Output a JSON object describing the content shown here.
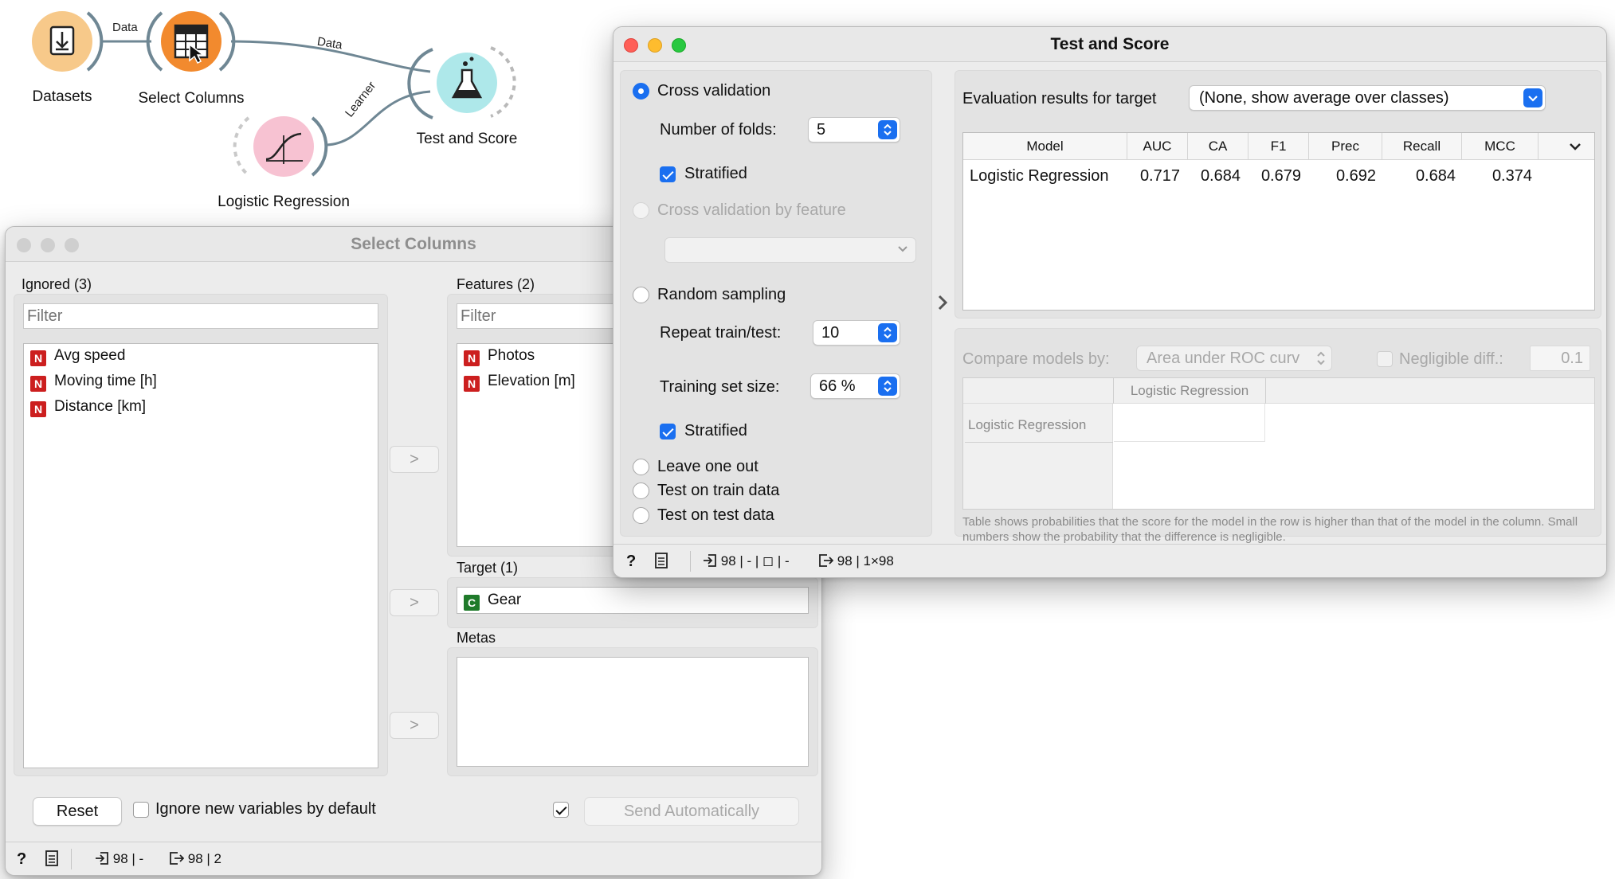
{
  "workflow": {
    "nodes": [
      {
        "label": "Datasets",
        "icon": "file-download-icon"
      },
      {
        "label": "Select Columns",
        "icon": "table-cursor-icon"
      },
      {
        "label": "Test and Score",
        "icon": "flask-icon"
      },
      {
        "label": "Logistic Regression",
        "icon": "sigmoid-curve-icon"
      }
    ],
    "links": [
      "Data",
      "Data",
      "Learner"
    ]
  },
  "select_columns": {
    "title": "Select Columns",
    "ignored": {
      "label": "Ignored (3)",
      "filter_placeholder": "Filter",
      "items": [
        {
          "tag": "N",
          "name": "Avg speed"
        },
        {
          "tag": "N",
          "name": "Moving time [h]"
        },
        {
          "tag": "N",
          "name": "Distance [km]"
        }
      ]
    },
    "features": {
      "label": "Features (2)",
      "filter_placeholder": "Filter",
      "items": [
        {
          "tag": "N",
          "name": "Photos"
        },
        {
          "tag": "N",
          "name": "Elevation [m]"
        }
      ]
    },
    "target": {
      "label": "Target (1)",
      "items": [
        {
          "tag": "C",
          "name": "Gear"
        }
      ]
    },
    "metas": {
      "label": "Metas",
      "items": []
    },
    "move_button": ">",
    "reset_label": "Reset",
    "ignore_new_label": "Ignore new variables by default",
    "send_label": "Send Automatically",
    "status": {
      "input": "98 | -",
      "output": "98 | 2"
    }
  },
  "test_and_score": {
    "title": "Test and Score",
    "cross_validation": "Cross validation",
    "folds_label": "Number of folds:",
    "folds_value": "5",
    "stratified_label": "Stratified",
    "cv_by_feature": "Cross validation by feature",
    "random_sampling": "Random sampling",
    "repeat_label": "Repeat train/test:",
    "repeat_value": "10",
    "train_size_label": "Training set size:",
    "train_size_value": "66 %",
    "leave_one_out": "Leave one out",
    "test_on_train": "Test on train data",
    "test_on_test": "Test on test data",
    "eval_label": "Evaluation results for target",
    "target_value": "(None, show average over classes)",
    "columns": [
      "Model",
      "AUC",
      "CA",
      "F1",
      "Prec",
      "Recall",
      "MCC"
    ],
    "rows": [
      {
        "model": "Logistic Regression",
        "AUC": "0.717",
        "CA": "0.684",
        "F1": "0.679",
        "Prec": "0.692",
        "Recall": "0.684",
        "MCC": "0.374"
      }
    ],
    "compare_label": "Compare models by:",
    "compare_value": "Area under ROC curv",
    "negligible_label": "Negligible diff.:",
    "negligible_value": "0.1",
    "compare_col_header": "Logistic Regression",
    "compare_row_header": "Logistic Regression",
    "note": "Table shows probabilities that the score for the model in the row is higher than that of the model in the column. Small numbers show the probability that the difference is negligible.",
    "status": {
      "input": "98 | - | ◻ | -",
      "output": "98 | 1×98"
    }
  },
  "colors": {
    "accent": "#1a6ff0",
    "datasets_node": "#f7c98a",
    "select_node": "#f28a2e",
    "test_node": "#aee8ea",
    "learner_node": "#f7c2d2",
    "numeric_tag": "#cc1f1f",
    "categorical_tag": "#1f7a2a"
  }
}
